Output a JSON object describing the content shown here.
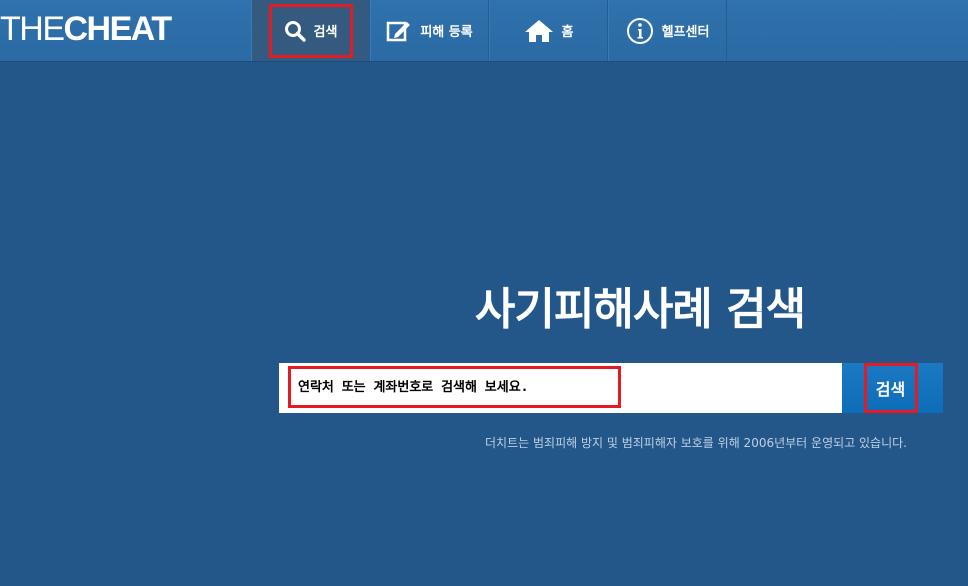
{
  "header": {
    "logo_light": "THE",
    "logo_bold": "CHEAT",
    "nav": {
      "search": {
        "label": "검색",
        "icon": "search-icon"
      },
      "report": {
        "label": "피해 등록",
        "icon": "edit-icon"
      },
      "home": {
        "label": "홈",
        "icon": "home-icon"
      },
      "help": {
        "label": "헬프센터",
        "icon": "info-icon"
      }
    }
  },
  "main": {
    "title": "사기피해사례 검색",
    "search": {
      "placeholder": "연락처 또는 계좌번호로 검색해 보세요.",
      "value": "",
      "button_label": "검색"
    },
    "description": "더치트는 범죄피해 방지 및 범죄피해자 보호를 위해 2006년부터 운영되고 있습니다."
  },
  "colors": {
    "background": "#23578a",
    "topbar": "#2d6ea8",
    "active_nav": "#345a7f",
    "button": "#1272bd",
    "highlight": "#e31c23"
  }
}
